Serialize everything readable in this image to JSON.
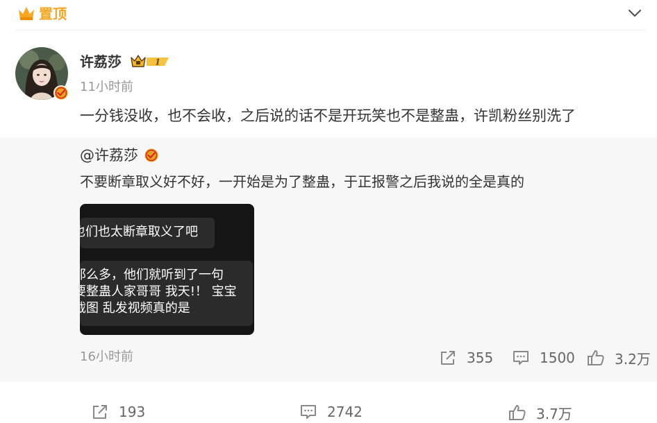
{
  "pin": {
    "label": "置顶",
    "icon": "crown-icon"
  },
  "post": {
    "author": "许荔莎",
    "vip_level": "1",
    "time": "11小时前",
    "text": "一分钱没收，也不会收，之后说的话不是开玩笑也不是整蛊，许凯粉丝别洗了"
  },
  "repost": {
    "mention": "@许荔莎",
    "text": "不要断章取义好不好，一开始是为了整蛊，于正报警之后我说的全是真的",
    "image_lines": [
      "也们也太断章取义了吧",
      "那么多，他们就听到了一句",
      "要整蛊人家哥哥 我天!！ 宝宝",
      "截图 乱发视频真的是"
    ],
    "time": "16小时前",
    "stats": {
      "share": "355",
      "comment": "1500",
      "like": "3.2万"
    }
  },
  "footer": {
    "share": "193",
    "comment": "2742",
    "like": "3.7万"
  },
  "colors": {
    "accent": "#f5a623",
    "verified": "#e8a020",
    "muted": "#999999",
    "repost_bg": "#f7f7f7"
  }
}
